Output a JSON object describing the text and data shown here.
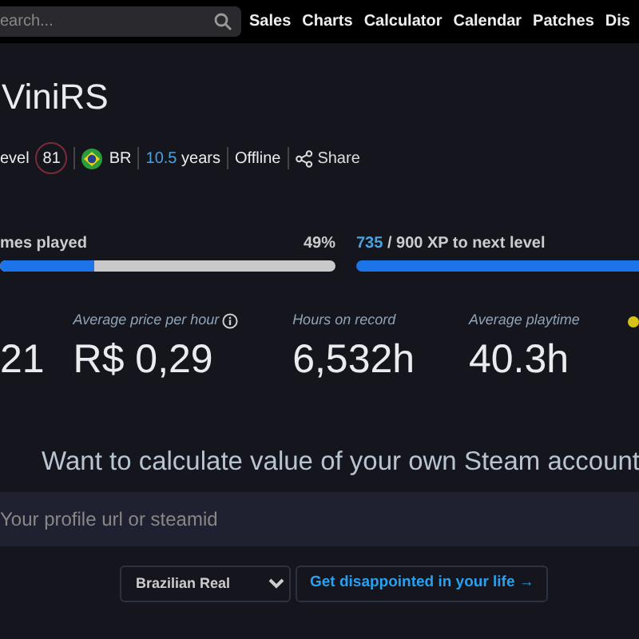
{
  "navbar": {
    "search": {
      "placeholder": "earch..."
    },
    "links": [
      {
        "label": "Sales"
      },
      {
        "label": "Charts"
      },
      {
        "label": "Calculator"
      },
      {
        "label": "Calendar"
      },
      {
        "label": "Patches"
      },
      {
        "label": "Dis"
      }
    ]
  },
  "profile": {
    "name": "ViniRS",
    "level_label": "evel",
    "level": "81",
    "country": "BR",
    "age_value": "10.5",
    "age_unit": "years",
    "status": "Offline",
    "share": "Share"
  },
  "progress": [
    {
      "label": "mes played",
      "reading": "49%",
      "level": 0.28
    },
    {
      "label_value": "735",
      "label": "/ 900 XP to next level",
      "level": 1
    }
  ],
  "stats": [
    {
      "value": "21"
    },
    {
      "label": "Average price per hour",
      "value": "R$ 0,29",
      "info": true
    },
    {
      "label": "Hours on record",
      "value": "6,532h"
    },
    {
      "label": "Average playtime",
      "value": "40.3h"
    }
  ],
  "calculate": {
    "heading": "Want to calculate value of your own Steam account",
    "placeholder": "Your profile url or steamid",
    "currency": "Brazilian Real",
    "button": "Get disappointed in your life →"
  }
}
